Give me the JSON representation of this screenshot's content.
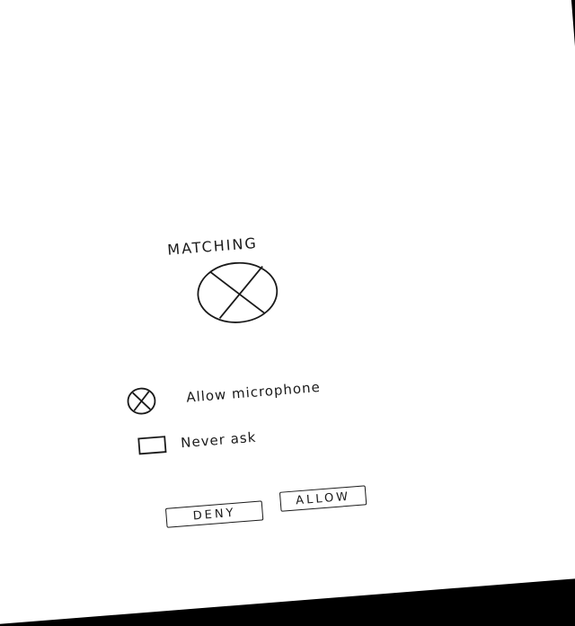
{
  "dialog": {
    "title": "MATCHING",
    "microphone_label": "Allow microphone",
    "never_ask_label": "Never ask",
    "deny_label": "DENY",
    "allow_label": "ALLOW"
  },
  "icons": {
    "hero": "placeholder-image-icon",
    "microphone": "placeholder-image-icon"
  }
}
